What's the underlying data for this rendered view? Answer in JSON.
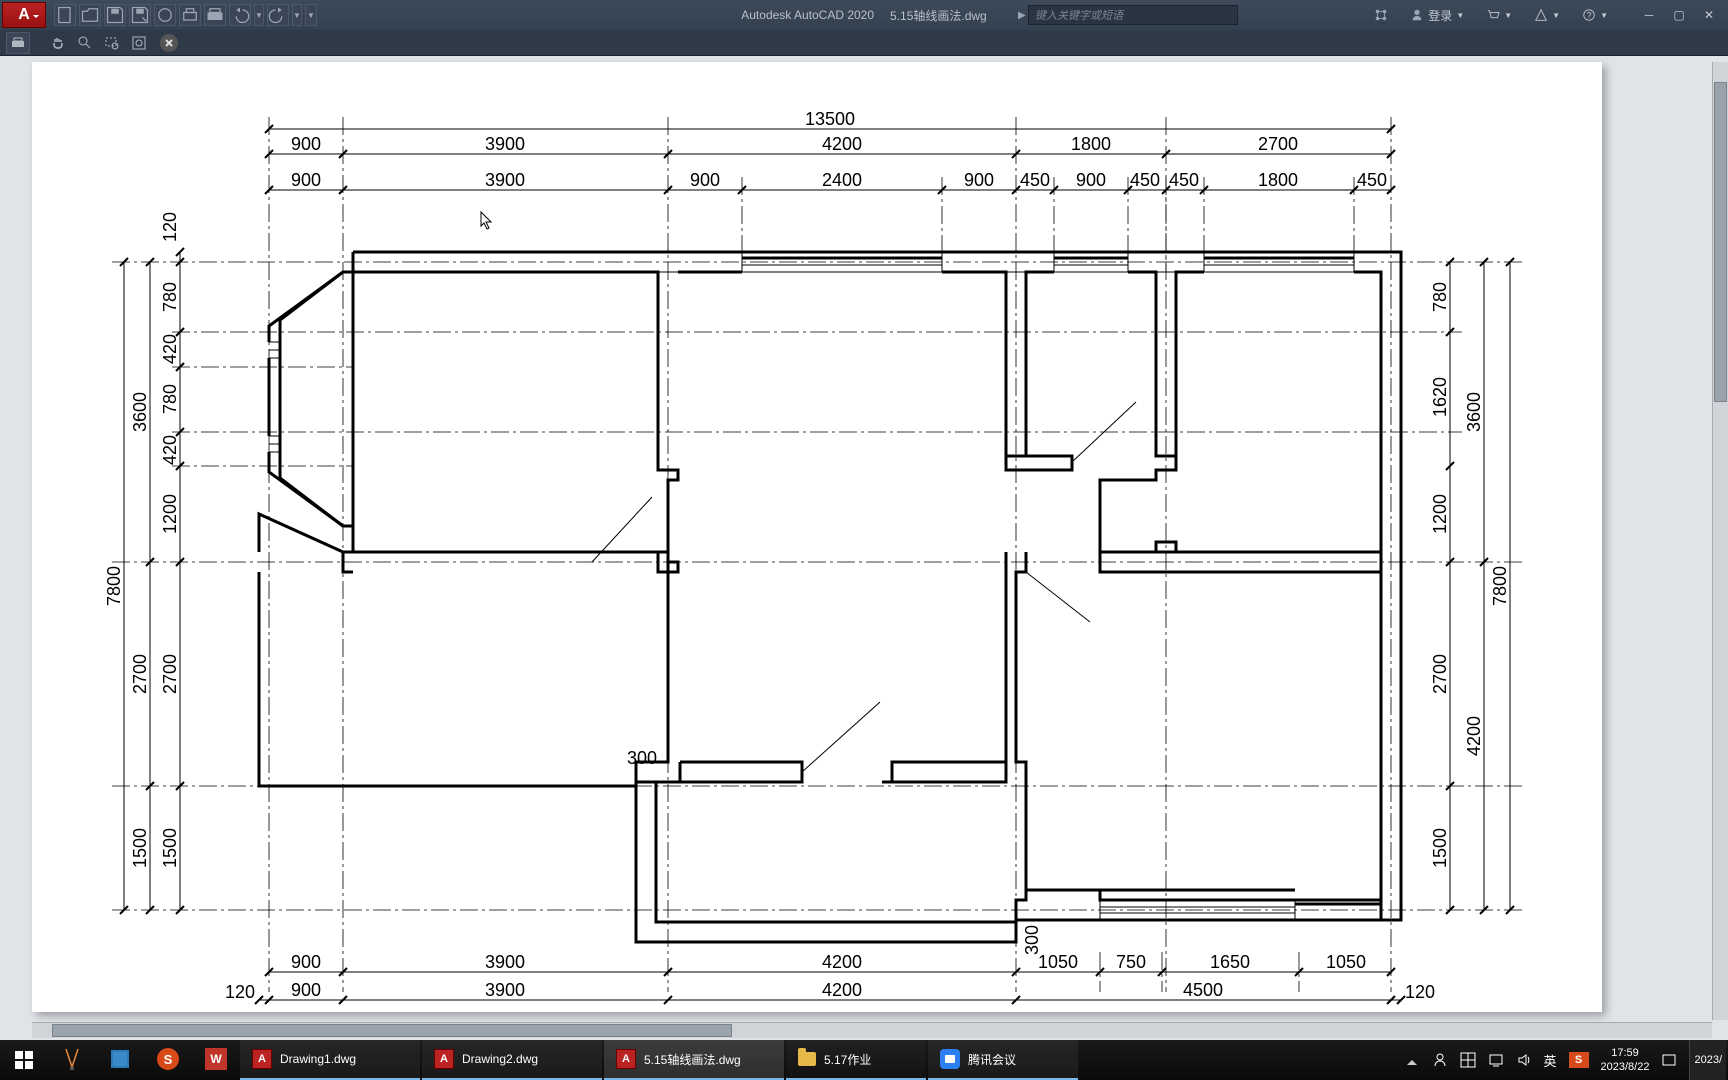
{
  "titlebar": {
    "app_letter": "A",
    "app_name": "Autodesk AutoCAD 2020",
    "file_name": "5.15轴线画法.dwg",
    "search_placeholder": "键入关键字或短语",
    "login": "登录"
  },
  "dimensions": {
    "top_overall": "13500",
    "top_row1": [
      "900",
      "3900",
      "4200",
      "1800",
      "2700"
    ],
    "top_row2": [
      "900",
      "3900",
      "900",
      "2400",
      "900",
      "450",
      "900",
      "450",
      "450",
      "1800",
      "450"
    ],
    "left_outer": "7800",
    "left_row1": [
      "3600",
      "2700",
      "1500"
    ],
    "left_row2": [
      "120",
      "780",
      "420",
      "780",
      "420",
      "1200",
      "2700",
      "1500"
    ],
    "right_outer": "7800",
    "right_row1": [
      "3600",
      "4200"
    ],
    "right_row2": [
      "780",
      "1620",
      "1200",
      "2700",
      "1500"
    ],
    "bottom_row1": [
      "900",
      "3900",
      "4200",
      "1050",
      "750",
      "1650",
      "1050"
    ],
    "bottom_row2_left": "120",
    "bottom_row2": [
      "900",
      "3900",
      "4200",
      "4500"
    ],
    "bottom_row2_right": "120",
    "extra1": "300",
    "extra2": "300"
  },
  "taskbar": {
    "tasks": [
      {
        "icon": "acad",
        "label": "Drawing1.dwg"
      },
      {
        "icon": "acad",
        "label": "Drawing2.dwg"
      },
      {
        "icon": "acad",
        "label": "5.15轴线画法.dwg"
      },
      {
        "icon": "folder",
        "label": "5.17作业"
      },
      {
        "icon": "tencent",
        "label": "腾讯会议"
      }
    ],
    "clock_time": "17:59",
    "clock_date": "2023/8/22",
    "ime_lang": "英",
    "ime_sogou": "S",
    "year_stub": "2023/"
  }
}
